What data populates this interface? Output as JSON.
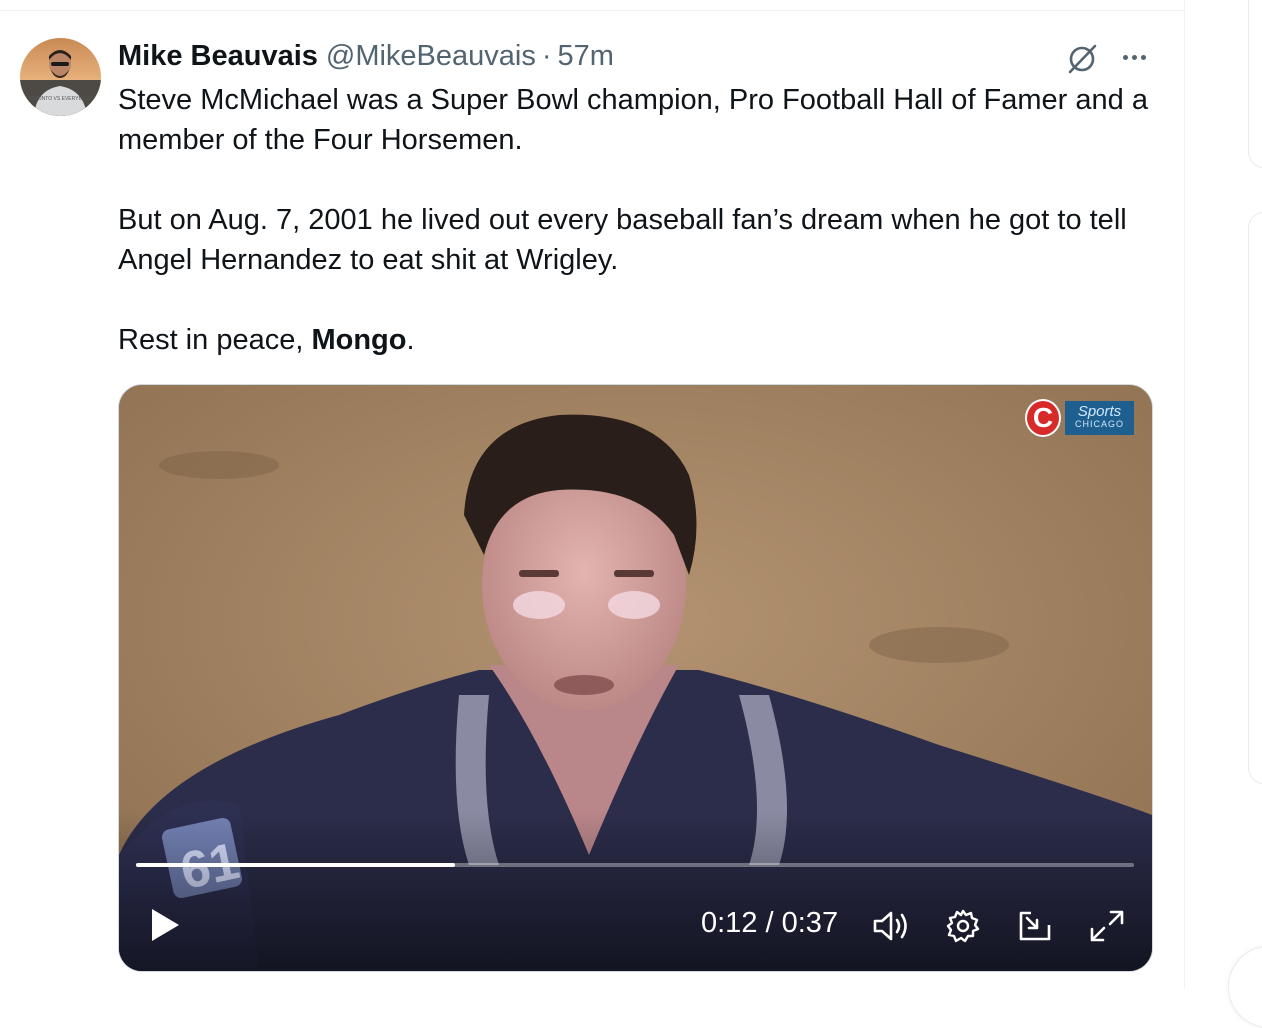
{
  "tweet": {
    "author_name": "Mike Beauvais",
    "handle": "@MikeBeauvais",
    "separator": "·",
    "time": "57m",
    "paragraph_1": "Steve McMichael was a Super Bowl champion, Pro Football Hall of Famer and a member of the Four Horsemen.",
    "paragraph_2": "But on Aug. 7, 2001 he lived out every baseball fan’s dream when he got to tell Angel Hernandez to eat shit at Wrigley.",
    "paragraph_3_prefix": "Rest in peace, ",
    "paragraph_3_bold": "Mongo",
    "paragraph_3_suffix": "."
  },
  "avatar": {
    "shirt_text": "TORONTO VS EVERYBODY"
  },
  "video": {
    "current_time": "0:12",
    "time_separator": " / ",
    "duration": "0:37",
    "progress_fraction": 0.32,
    "overlay_logo_letter": "C",
    "overlay_network": "Sports",
    "overlay_network_sub": "CHICAGO",
    "jersey_text": "61"
  },
  "icons": {
    "grok": "grok-icon",
    "more": "more-icon",
    "play": "play-icon",
    "volume": "volume-icon",
    "settings": "settings-icon",
    "pip": "picture-in-picture-icon",
    "fullscreen": "fullscreen-icon"
  },
  "colors": {
    "text_primary": "#0f1419",
    "text_secondary": "#536471",
    "border": "#cfd9de",
    "video_badge_red": "#d92a2a",
    "video_badge_blue": "#1f5f8f"
  }
}
